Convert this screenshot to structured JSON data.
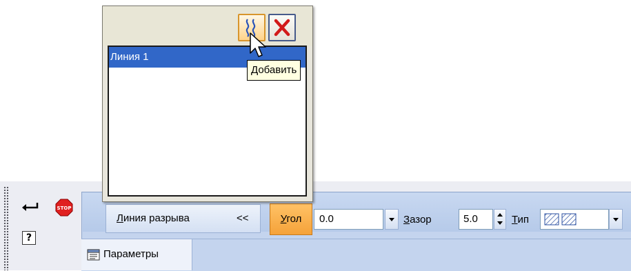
{
  "popup": {
    "buttons": {
      "add_icon": "break-wave-icon",
      "delete_icon": "red-x-icon"
    },
    "items": [
      "Линия 1"
    ],
    "tooltip": "Добавить"
  },
  "toolbar": {
    "command_icons": [
      "enter-arrow-icon",
      "stop-icon",
      "help-icon"
    ],
    "break_line_button": {
      "label": "Линия разрыва",
      "underlined_char": "Л",
      "chevron": "<<"
    },
    "angle": {
      "label": "Угол",
      "underlined_char": "У",
      "value": "0.0"
    },
    "gap": {
      "label": "Зазор",
      "underlined_char": "З",
      "value": "5.0"
    },
    "type": {
      "label": "Тип",
      "underlined_char": "Т",
      "icon": "hatch-pattern-icon"
    },
    "tabs": [
      {
        "label": "Параметры",
        "icon": "parameters-icon"
      }
    ]
  },
  "colors": {
    "selection": "#3167c8",
    "tooltip_bg": "#ffffe1",
    "panel_bg": "#c4d4ee",
    "highlight_orange": "#f5a23a",
    "stop_red": "#e02020"
  }
}
